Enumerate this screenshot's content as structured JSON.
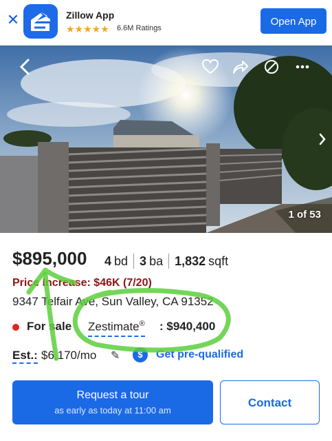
{
  "app_banner": {
    "app_name": "Zillow App",
    "stars": "★★★★★",
    "ratings": "6.6M Ratings",
    "open_button": "Open App"
  },
  "photo": {
    "counter": "1 of 53"
  },
  "listing": {
    "price": "$895,000",
    "beds_value": "4",
    "beds_unit": "bd",
    "baths_value": "3",
    "baths_unit": "ba",
    "sqft_value": "1,832",
    "sqft_unit": "sqft",
    "price_change": "Price Increase: $46K (7/20)",
    "address": "9347 Telfair Ave, Sun Valley, CA 91352",
    "status": "For sale",
    "zestimate_label": "Zestimate",
    "zestimate_reg": "®",
    "zestimate_value": ": $940,400",
    "est_label": "Est.:",
    "est_payment": "$6,170/mo",
    "prequal_link": "Get pre-qualified"
  },
  "actions": {
    "tour_label": "Request a tour",
    "tour_sub": "as early as today at 11:00 am",
    "contact_label": "Contact"
  },
  "colors": {
    "brand_blue": "#1a6ae6",
    "price_change_red": "#8b1515",
    "status_dot_red": "#e0271f",
    "annotation_green": "#5ccf3c"
  }
}
